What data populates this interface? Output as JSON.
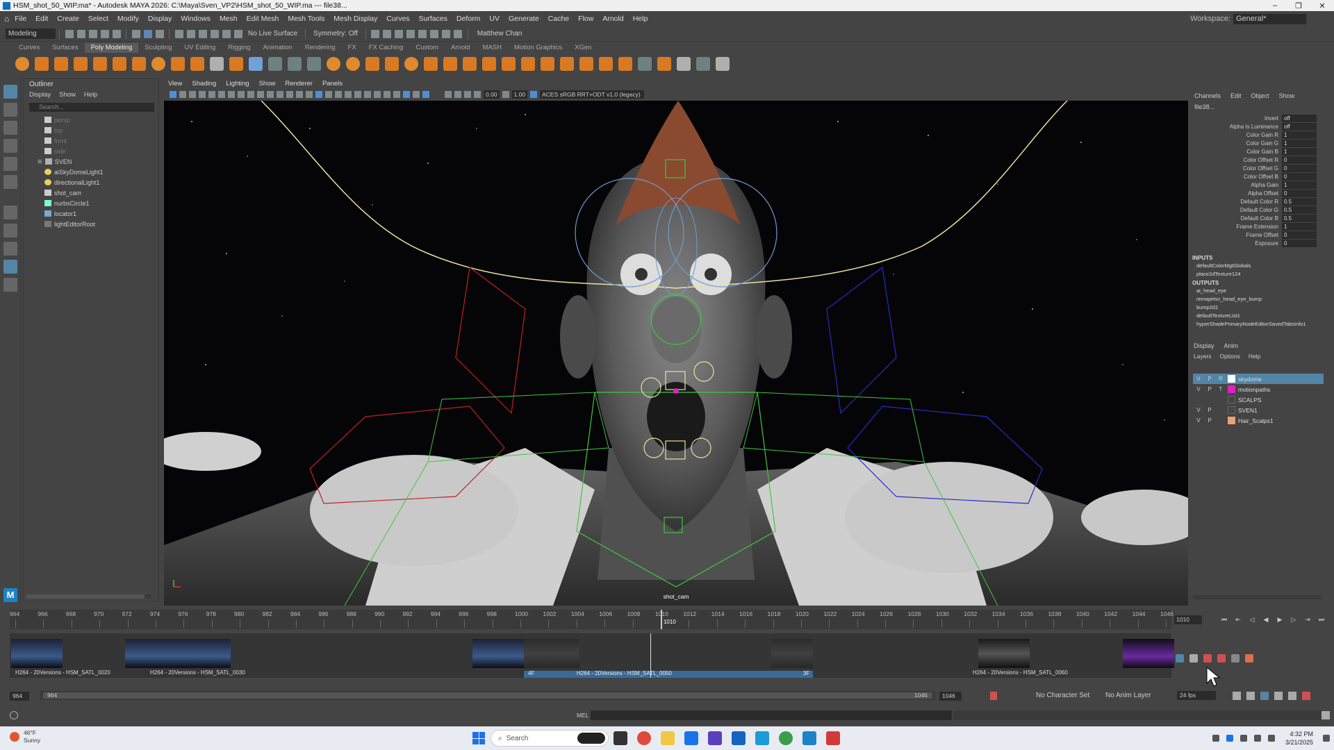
{
  "window": {
    "title": "HSM_shot_50_WIP.ma* - Autodesk MAYA 2026: C:\\Maya\\Sven_VP2\\HSM_shot_50_WIP.ma  ---  file38..."
  },
  "menubar": {
    "items": [
      "File",
      "Edit",
      "Create",
      "Select",
      "Modify",
      "Display",
      "Windows",
      "Mesh",
      "Edit Mesh",
      "Mesh Tools",
      "Mesh Display",
      "Curves",
      "Surfaces",
      "Deform",
      "UV",
      "Generate",
      "Cache",
      "Flow",
      "Arnold",
      "Help"
    ],
    "workspace_label": "Workspace:",
    "workspace_value": "General*"
  },
  "statusline": {
    "mode": "Modeling",
    "live_surface": "No Live Surface",
    "symmetry": "Symmetry: Off",
    "user": "Matthew Chan"
  },
  "shelf": {
    "tabs": [
      "Curves",
      "Surfaces",
      "Poly Modeling",
      "Sculpting",
      "UV Editing",
      "Rigging",
      "Animation",
      "Rendering",
      "FX",
      "FX Caching",
      "Custom",
      "Arnold",
      "MASH",
      "Motion Graphics",
      "XGen"
    ],
    "active": "Poly Modeling"
  },
  "outliner": {
    "title": "Outliner",
    "menu": [
      "Display",
      "Show",
      "Help"
    ],
    "search_placeholder": "Search...",
    "items": [
      {
        "label": "persp",
        "icon": "camera-icon",
        "dim": true
      },
      {
        "label": "top",
        "icon": "camera-icon",
        "dim": true
      },
      {
        "label": "front",
        "icon": "camera-icon",
        "dim": true
      },
      {
        "label": "side",
        "icon": "camera-icon",
        "dim": true
      },
      {
        "label": "SVEN",
        "icon": "group-icon",
        "dim": false
      },
      {
        "label": "aiSkyDomeLight1",
        "icon": "light-icon",
        "dim": false
      },
      {
        "label": "directionalLight1",
        "icon": "light-icon",
        "dim": false
      },
      {
        "label": "shot_cam",
        "icon": "camera-icon",
        "dim": false
      },
      {
        "label": "nurbsCircle1",
        "icon": "curve-icon",
        "dim": false
      },
      {
        "label": "locator1",
        "icon": "locator-icon",
        "dim": false
      },
      {
        "label": "lightEditorRoot",
        "icon": "light-root-icon",
        "dim": false
      }
    ]
  },
  "viewport": {
    "menu": [
      "View",
      "Shading",
      "Lighting",
      "Show",
      "Renderer",
      "Panels"
    ],
    "field1": "0.00",
    "field2": "1.00",
    "colorspace": "ACES sRGB RRT+ODT v1.0 (legacy)",
    "camera_label": "shot_cam"
  },
  "channelbox": {
    "menu": [
      "Channels",
      "Edit",
      "Object",
      "Show"
    ],
    "node": "file38...",
    "attributes": [
      {
        "name": "Invert",
        "value": "off"
      },
      {
        "name": "Alpha Is Luminance",
        "value": "off"
      },
      {
        "name": "Color Gain R",
        "value": "1"
      },
      {
        "name": "Color Gain G",
        "value": "1"
      },
      {
        "name": "Color Gain B",
        "value": "1"
      },
      {
        "name": "Color Offset R",
        "value": "0"
      },
      {
        "name": "Color Offset G",
        "value": "0"
      },
      {
        "name": "Color Offset B",
        "value": "0"
      },
      {
        "name": "Alpha Gain",
        "value": "1"
      },
      {
        "name": "Alpha Offset",
        "value": "0"
      },
      {
        "name": "Default Color R",
        "value": "0.5"
      },
      {
        "name": "Default Color G",
        "value": "0.5"
      },
      {
        "name": "Default Color B",
        "value": "0.5"
      },
      {
        "name": "Frame Extension",
        "value": "1"
      },
      {
        "name": "Frame Offset",
        "value": "0"
      },
      {
        "name": "Exposure",
        "value": "0"
      }
    ],
    "inputs_label": "INPUTS",
    "inputs": [
      "defaultColorMgtGlobals",
      "place2dTexture124"
    ],
    "outputs_label": "OUTPUTS",
    "outputs": [
      "ai_head_eye",
      "remapHsv_head_eye_bump",
      "bump2d1",
      "defaultTextureList1",
      "hyperShadePrimaryNodeEditorSavedTabsInfo1"
    ]
  },
  "layers": {
    "tabs": [
      "Display",
      "Anim"
    ],
    "menu": [
      "Layers",
      "Options",
      "Help"
    ],
    "items": [
      {
        "v": "V",
        "p": "P",
        "t": "R",
        "name": "skydome",
        "color": "#ffffff",
        "selected": true
      },
      {
        "v": "V",
        "p": "P",
        "t": "T",
        "name": "motionpaths",
        "color": "#e020c0",
        "selected": false
      },
      {
        "v": "",
        "p": "",
        "t": "",
        "name": "SCALPS",
        "color": "#444444",
        "selected": false
      },
      {
        "v": "V",
        "p": "P",
        "t": "",
        "name": "SVEN1",
        "color": "#444444",
        "selected": false
      },
      {
        "v": "V",
        "p": "P",
        "t": "",
        "name": "Hair_Scalps1",
        "color": "#f0a070",
        "selected": false
      }
    ]
  },
  "timeslider": {
    "ticks": [
      "964",
      "966",
      "968",
      "970",
      "972",
      "974",
      "976",
      "978",
      "980",
      "982",
      "984",
      "986",
      "988",
      "990",
      "992",
      "994",
      "996",
      "998",
      "1000",
      "1002",
      "1004",
      "1006",
      "1008",
      "1010",
      "1012",
      "1014",
      "1016",
      "1018",
      "1020",
      "1022",
      "1024",
      "1026",
      "1028",
      "1030",
      "1032",
      "1034",
      "1036",
      "1038",
      "1040",
      "1042",
      "1044",
      "1046"
    ],
    "current_frame": "1010",
    "frame_field": "1010"
  },
  "sequencer": {
    "clips": [
      {
        "label": "H264 - 20Versions - HSM_SATL_0020"
      },
      {
        "label": "H264 - 20Versions - HSM_SATL_0030"
      },
      {
        "label": "H264 - 20Versions - HSM_SATL_0050"
      },
      {
        "label": "H264 - 20Versions - HSM_SATL_0060"
      }
    ],
    "handle_in": "4F",
    "handle_out": "3F"
  },
  "range": {
    "start": "964",
    "start2": "964",
    "end": "1046",
    "end2": "1046",
    "character_set": "No Character Set",
    "anim_layer": "No Anim Layer",
    "fps": "24 fps"
  },
  "cmdline": {
    "mel": "MEL"
  },
  "taskbar": {
    "temp": "46°F",
    "weather": "Sunny",
    "search": "Search",
    "time": "4:32 PM",
    "date": "3/21/2025"
  }
}
